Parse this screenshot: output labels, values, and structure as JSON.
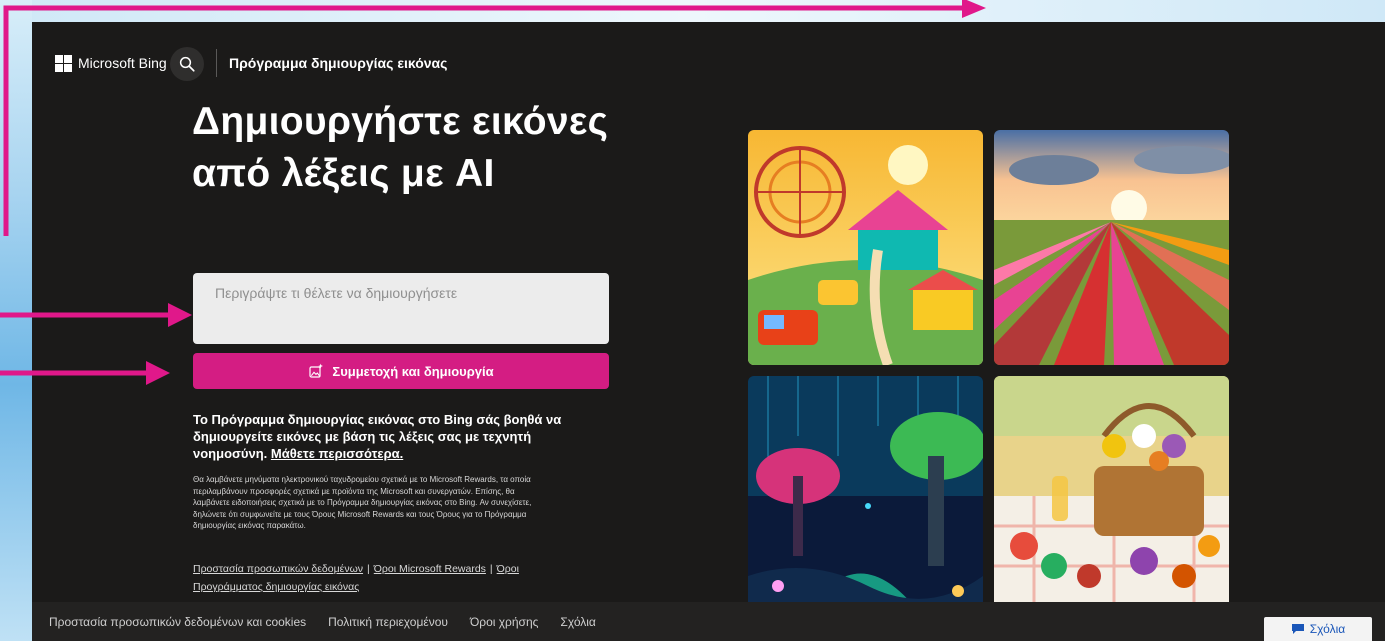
{
  "header": {
    "brand": "Microsoft Bing",
    "product_title": "Πρόγραμμα δημιουργίας εικόνας"
  },
  "hero": {
    "title": "Δημιουργήστε εικόνες από λέξεις με AI"
  },
  "prompt": {
    "placeholder": "Περιγράψτε τι θέλετε να δημιουργήσετε",
    "value": ""
  },
  "create_button": {
    "label": "Συμμετοχή και δημιουργία",
    "icon": "image-sparkle-icon"
  },
  "description": {
    "text": "Το Πρόγραμμα δημιουργίας εικόνας στο Bing σάς βοηθά να δημιουργείτε εικόνες με βάση τις λέξεις σας με τεχνητή νοημοσύνη.",
    "learn_more": "Μάθετε περισσότερα."
  },
  "fine_print": "Θα λαμβάνετε μηνύματα ηλεκτρονικού ταχυδρομείου σχετικά με το Microsoft Rewards, τα οποία περιλαμβάνουν προσφορές σχετικά με προϊόντα της Microsoft και συνεργατών. Επίσης, θα λαμβάνετε ειδοποιήσεις σχετικά με το Πρόγραμμα δημιουργίας εικόνας στο Bing. Αν συνεχίσετε, δηλώνετε ότι συμφωνείτε με τους Όρους Microsoft Rewards και τους Όρους για το Πρόγραμμα δημιουργίας εικόνας παρακάτω.",
  "legal_links": {
    "privacy": "Προστασία προσωπικών δεδομένων",
    "rewards_terms": "Όροι Microsoft Rewards",
    "creator_terms": "Όροι Προγράμματος δημιουργίας εικόνας",
    "separator": "|"
  },
  "footer": {
    "links": [
      "Προστασία προσωπικών δεδομένων και cookies",
      "Πολιτική περιεχομένου",
      "Όροι χρήσης",
      "Σχόλια"
    ],
    "feedback_button": "Σχόλια"
  },
  "colors": {
    "page_bg": "#1b1a19",
    "accent": "#d41d83",
    "annotation": "#e0188a"
  },
  "icons": {
    "search": "search-icon",
    "logo": "microsoft-logo-icon",
    "feedback": "chat-bubble-icon"
  }
}
